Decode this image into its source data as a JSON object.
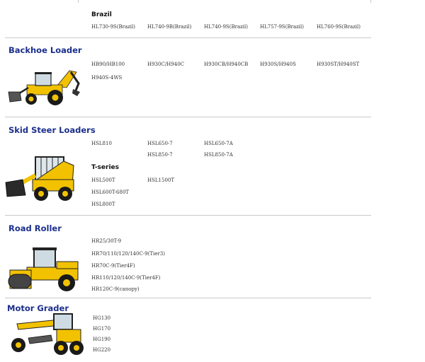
{
  "brazil": {
    "subtitle": "Brazil",
    "models": [
      "HL730-9S(Brazil)",
      "HL740-9B(Brazil)",
      "HL740-9S(Brazil)",
      "HL757-9S(Brazil)",
      "HL760-9S(Brazil)"
    ]
  },
  "backhoe": {
    "title": "Backhoe Loader",
    "models": [
      "HB90/HB100",
      "H930C/H940C",
      "H930CB/H940CB",
      "H930S/H940S",
      "H930ST/H940ST",
      "H940S-4WS"
    ]
  },
  "skid": {
    "title": "Skid Steer Loaders",
    "models": [
      "HSL810",
      "HSL650-7",
      "HSL650-7A",
      "HSL850-7",
      "HSL850-7A"
    ],
    "tseries": {
      "subtitle": "T-series",
      "models": [
        "HSL500T",
        "HSL1500T",
        "HSL600T-680T",
        "HSL800T"
      ]
    }
  },
  "roller": {
    "title": "Road Roller",
    "models": [
      "HR25/30T-9",
      "HR70/110/120/140C-9(Tier3)",
      "HR70C-9(Tier4F)",
      "HR110/120/140C-9(Tier4F)",
      "HR120C-9(canopy)"
    ]
  },
  "grader": {
    "title": "Motor Grader",
    "models": [
      "HG130",
      "HG170",
      "HG190",
      "HG220"
    ]
  },
  "colors": {
    "title_blue": "#1c2f8c",
    "machine_yellow": "#f2c200",
    "divider": "#c9c9c9"
  }
}
